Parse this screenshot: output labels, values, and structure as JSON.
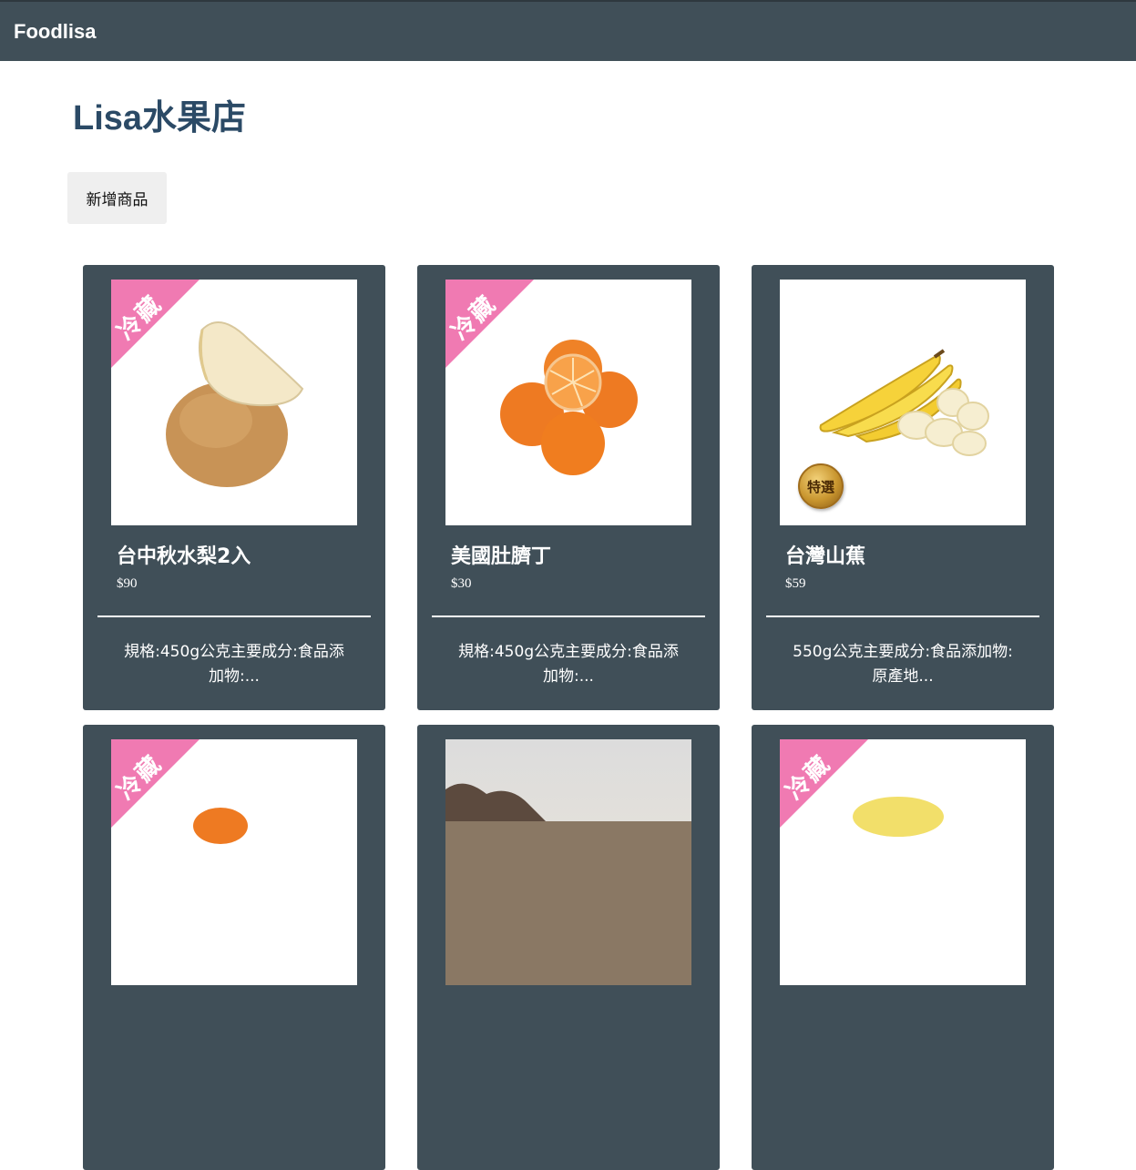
{
  "navbar": {
    "brand": "Foodlisa"
  },
  "page": {
    "title": "Lisa水果店"
  },
  "toolbar": {
    "add_label": "新增商品"
  },
  "labels": {
    "chilled": "冷藏",
    "selected": "特選"
  },
  "colors": {
    "nav_bg": "#404f58",
    "card_bg": "#404f58",
    "title": "#2b4a66",
    "ribbon": "#f07ab2"
  },
  "products": [
    {
      "name": "台中秋水梨2入",
      "price": "$90",
      "desc": "規格:450g公克主要成分:食品添加物:...",
      "chilled": true,
      "selected": false,
      "image": "pear"
    },
    {
      "name": "美國肚臍丁",
      "price": "$30",
      "desc": "規格:450g公克主要成分:食品添加物:...",
      "chilled": true,
      "selected": false,
      "image": "oranges"
    },
    {
      "name": "台灣山蕉",
      "price": "$59",
      "desc": "550g公克主要成分:食品添加物:原產地...",
      "chilled": false,
      "selected": true,
      "image": "bananas"
    },
    {
      "chilled": true,
      "selected": false,
      "image": "orange"
    },
    {
      "chilled": false,
      "selected": false,
      "image": "landscape"
    },
    {
      "chilled": true,
      "selected": false,
      "image": "pineapple"
    }
  ]
}
